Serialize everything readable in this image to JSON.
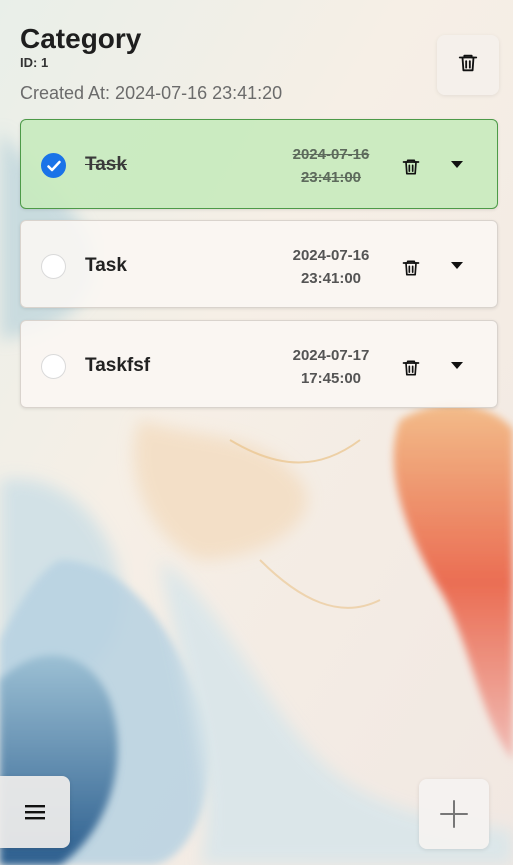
{
  "category": {
    "title": "Category",
    "id_label": "ID: 1",
    "created_label": "Created At: 2024-07-16 23:41:20"
  },
  "tasks": [
    {
      "name": "Task",
      "date": "2024-07-16",
      "time": "23:41:00",
      "completed": true
    },
    {
      "name": "Task",
      "date": "2024-07-16",
      "time": "23:41:00",
      "completed": false
    },
    {
      "name": "Taskfsf",
      "date": "2024-07-17",
      "time": "17:45:00",
      "completed": false
    }
  ],
  "icons": {
    "delete": "trash-icon",
    "expand": "caret-down-icon",
    "check": "check-icon",
    "menu": "hamburger-icon",
    "add": "plus-icon"
  },
  "colors": {
    "completed_bg": "#c8eabe",
    "completed_border": "#4d9a48",
    "check_blue": "#1a73e8"
  }
}
